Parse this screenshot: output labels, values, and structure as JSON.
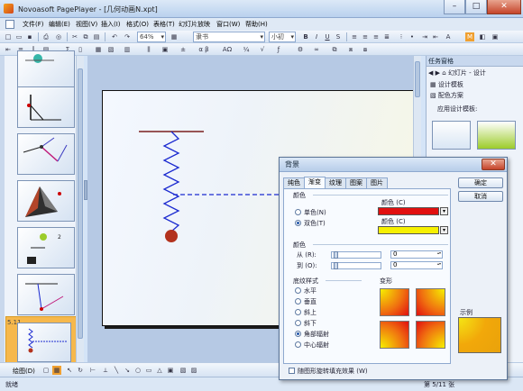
{
  "window": {
    "title": "Novoasoft PagePlayer - [几何动画N.xpt]",
    "buttons": [
      "minimize",
      "maximize",
      "close"
    ]
  },
  "menu": {
    "items": [
      "文件(F)",
      "编辑(E)",
      "视图(V)",
      "插入(I)",
      "格式(O)",
      "表格(T)",
      "幻灯片放映",
      "窗口(W)",
      "帮助(H)"
    ]
  },
  "toolbar1": {
    "zoom": "64%",
    "font_name": "隶书",
    "font_size": "小初"
  },
  "toolbar2": {
    "symbols": [
      "Σ",
      "α β",
      "ΑΩ",
      "¼",
      "√"
    ]
  },
  "slides_panel": {
    "selected_slide_number": "5.11"
  },
  "task_pane": {
    "title": "任务窗格",
    "nav_label": "幻灯片 - 设计",
    "items": [
      "设计模板",
      "配色方案"
    ],
    "section": "应用设计模板:"
  },
  "drawbar": {
    "label": "绘图(D)"
  },
  "status": {
    "left": "就绪",
    "right": "第 5/11 张"
  },
  "dialog": {
    "title": "背景",
    "tabs": [
      "纯色",
      "渐变",
      "纹理",
      "图案",
      "图片"
    ],
    "active_tab": "渐变",
    "colors": {
      "section": "颜色",
      "single_color": "单色(N)",
      "two_colors": "双色(T)",
      "selected_mode": "双色(T)",
      "color1_label": "颜色 (C)",
      "color2_label": "颜色 (C)",
      "color1": "#e11010",
      "color2": "#f6f000"
    },
    "transparency": {
      "section": "颜色",
      "from_label": "从 (R):",
      "to_label": "到 (O):",
      "from_value": "0",
      "to_value": "0"
    },
    "shading": {
      "section": "底纹样式",
      "styles": [
        "水平",
        "垂直",
        "斜上",
        "斜下",
        "角部辐射",
        "中心辐射"
      ],
      "selected": "角部辐射",
      "variants_label": "变形"
    },
    "rotate_checkbox": "随图形旋转填充效果 (W)",
    "ok": "确定",
    "cancel": "取消",
    "sample_label": "示例"
  }
}
